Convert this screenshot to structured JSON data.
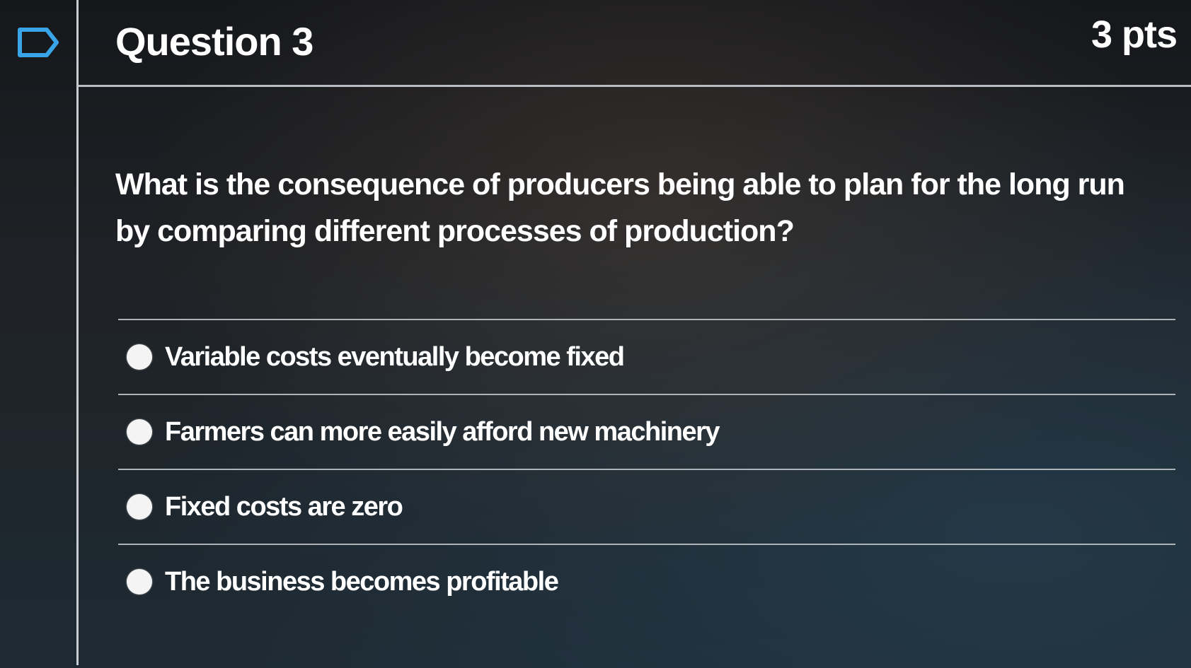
{
  "question": {
    "title": "Question 3",
    "points": "3 pts",
    "text": "What is the consequence of producers being able to plan for the long run by comparing different processes of production?",
    "answers": [
      {
        "label": "Variable costs eventually become fixed"
      },
      {
        "label": "Farmers can more easily afford new machinery"
      },
      {
        "label": "Fixed costs are zero"
      },
      {
        "label": "The business becomes profitable"
      }
    ]
  },
  "icons": {
    "flag": "bookmark-flag-icon"
  },
  "colors": {
    "flag_accent": "#3aa4e8",
    "text": "#ffffff",
    "divider": "#b9bdc2"
  }
}
